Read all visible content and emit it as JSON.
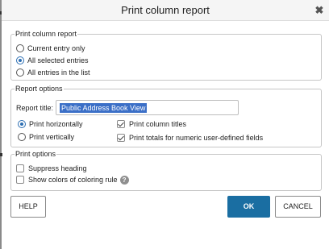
{
  "dialog": {
    "title": "Print column report",
    "close_glyph": "✖"
  },
  "print_column_report": {
    "legend": "Print column report",
    "options": [
      {
        "label": "Current entry only",
        "selected": false
      },
      {
        "label": "All selected entries",
        "selected": true
      },
      {
        "label": "All entries in the list",
        "selected": false
      }
    ]
  },
  "report_options": {
    "legend": "Report options",
    "title_label": "Report title:",
    "title_value": "Public Address Book View",
    "orientation": [
      {
        "label": "Print horizontally",
        "selected": true
      },
      {
        "label": "Print vertically",
        "selected": false
      }
    ],
    "checks": [
      {
        "label": "Print column titles",
        "checked": true
      },
      {
        "label": "Print totals for numeric user-defined fields",
        "checked": true
      }
    ]
  },
  "print_options": {
    "legend": "Print options",
    "checks": [
      {
        "label": "Suppress heading",
        "checked": false
      },
      {
        "label": "Show colors of coloring rule",
        "checked": false
      }
    ],
    "help_glyph": "?"
  },
  "buttons": {
    "help": "HELP",
    "ok": "OK",
    "cancel": "CANCEL"
  },
  "colors": {
    "accent": "#1a6ea2",
    "selection": "#3b6fc7"
  }
}
